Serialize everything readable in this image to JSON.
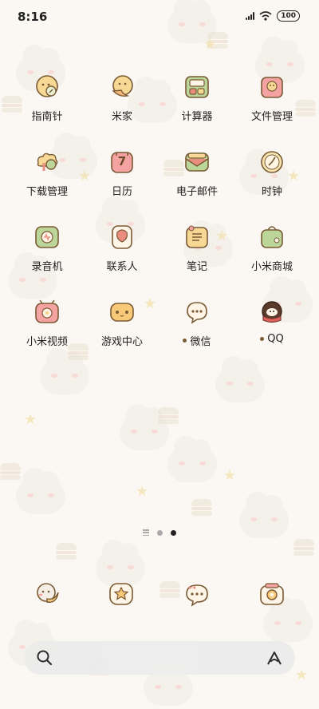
{
  "status": {
    "time": "8:16",
    "battery": "100"
  },
  "apps": [
    {
      "label": "指南针",
      "icon": "compass-icon"
    },
    {
      "label": "米家",
      "icon": "mijia-icon"
    },
    {
      "label": "计算器",
      "icon": "calculator-icon"
    },
    {
      "label": "文件管理",
      "icon": "file-manager-icon"
    },
    {
      "label": "下载管理",
      "icon": "download-manager-icon"
    },
    {
      "label": "日历",
      "icon": "calendar-icon",
      "calendar_day": "7"
    },
    {
      "label": "电子邮件",
      "icon": "email-icon"
    },
    {
      "label": "时钟",
      "icon": "clock-icon"
    },
    {
      "label": "录音机",
      "icon": "recorder-icon"
    },
    {
      "label": "联系人",
      "icon": "contacts-icon"
    },
    {
      "label": "笔记",
      "icon": "notes-icon"
    },
    {
      "label": "小米商城",
      "icon": "mi-store-icon"
    },
    {
      "label": "小米视频",
      "icon": "mi-video-icon"
    },
    {
      "label": "游戏中心",
      "icon": "game-center-icon"
    },
    {
      "label": "微信",
      "icon": "wechat-icon",
      "new_dot": true
    },
    {
      "label": "QQ",
      "icon": "qq-icon",
      "new_dot": true
    }
  ],
  "pager": {
    "pages": 2,
    "current": 2
  },
  "dock": [
    "phone-icon",
    "gallery-icon",
    "messages-icon",
    "camera-icon"
  ],
  "search": {
    "left_icon": "search-icon",
    "right_icon": "ai-assistant-icon"
  },
  "colors": {
    "background": "#fbf8f3",
    "text": "#222222",
    "icon_outline": "#7a5a36"
  }
}
